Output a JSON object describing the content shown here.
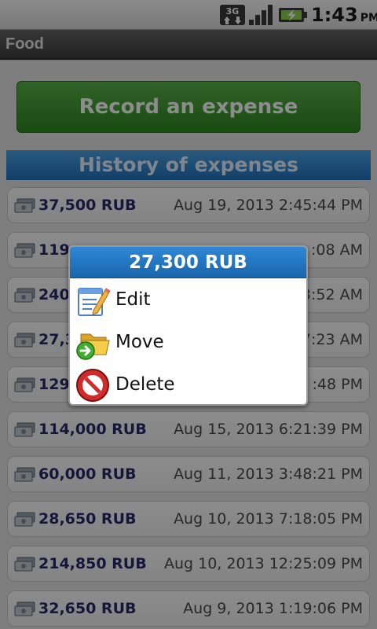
{
  "status_bar": {
    "network_icon": "3g-icon",
    "signal_icon": "signal-icon",
    "battery_icon": "battery-charging-icon",
    "time": "1:43",
    "ampm": "PM"
  },
  "title_bar": {
    "title": "Food"
  },
  "record_button": {
    "label": "Record an expense"
  },
  "history": {
    "header": "History of expenses",
    "rows": [
      {
        "amount": "37,500 RUB",
        "date": "Aug 19, 2013 2:45:44 PM"
      },
      {
        "amount": "119",
        "date": ":08 AM"
      },
      {
        "amount": "240",
        "date": "3:52 AM"
      },
      {
        "amount": "27,3",
        "date": "7:23 AM"
      },
      {
        "amount": "129",
        "date": ":48 PM"
      },
      {
        "amount": "114,000 RUB",
        "date": "Aug 15, 2013 6:21:39 PM"
      },
      {
        "amount": "60,000 RUB",
        "date": "Aug 11, 2013 3:48:21 PM"
      },
      {
        "amount": "28,650 RUB",
        "date": "Aug 10, 2013 7:18:05 PM"
      },
      {
        "amount": "214,850 RUB",
        "date": "Aug 10, 2013 12:25:09 PM"
      },
      {
        "amount": "32,650 RUB",
        "date": "Aug 9, 2013 1:19:06 PM"
      }
    ]
  },
  "context_menu": {
    "title": "27,300 RUB",
    "items": [
      {
        "label": "Edit",
        "icon": "edit-icon"
      },
      {
        "label": "Move",
        "icon": "move-folder-icon"
      },
      {
        "label": "Delete",
        "icon": "delete-icon"
      }
    ]
  }
}
